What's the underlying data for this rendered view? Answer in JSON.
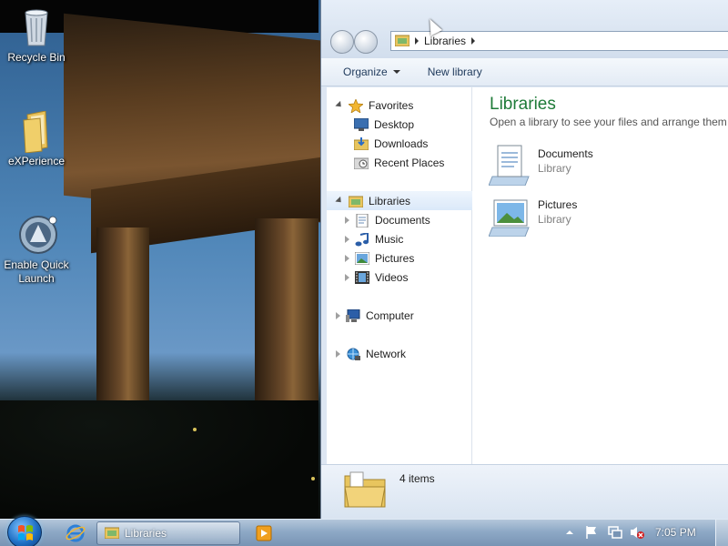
{
  "desktop": {
    "icons": [
      {
        "label": "Recycle Bin",
        "icon": "recycle-bin-icon"
      },
      {
        "label": "eXPerience",
        "icon": "folder-icon"
      },
      {
        "label": "Enable Quick Launch",
        "icon": "quick-launch-icon"
      }
    ]
  },
  "explorer": {
    "address": {
      "crumb": "Libraries"
    },
    "toolbar": {
      "organize_label": "Organize",
      "new_library_label": "New library"
    },
    "nav": {
      "favorites": {
        "label": "Favorites",
        "items": [
          "Desktop",
          "Downloads",
          "Recent Places"
        ]
      },
      "libraries": {
        "label": "Libraries",
        "items": [
          "Documents",
          "Music",
          "Pictures",
          "Videos"
        ]
      },
      "computer": {
        "label": "Computer"
      },
      "network": {
        "label": "Network"
      }
    },
    "content": {
      "title": "Libraries",
      "subtitle": "Open a library to see your files and arrange them b",
      "items": [
        {
          "name": "Documents",
          "type": "Library"
        },
        {
          "name": "Pictures",
          "type": "Library"
        }
      ]
    },
    "details": {
      "count": "4 items"
    }
  },
  "taskbar": {
    "task_label": "Libraries",
    "clock": "7:05 PM"
  },
  "colors": {
    "accent_green": "#1e7b38",
    "link_blue": "#1e395b"
  }
}
